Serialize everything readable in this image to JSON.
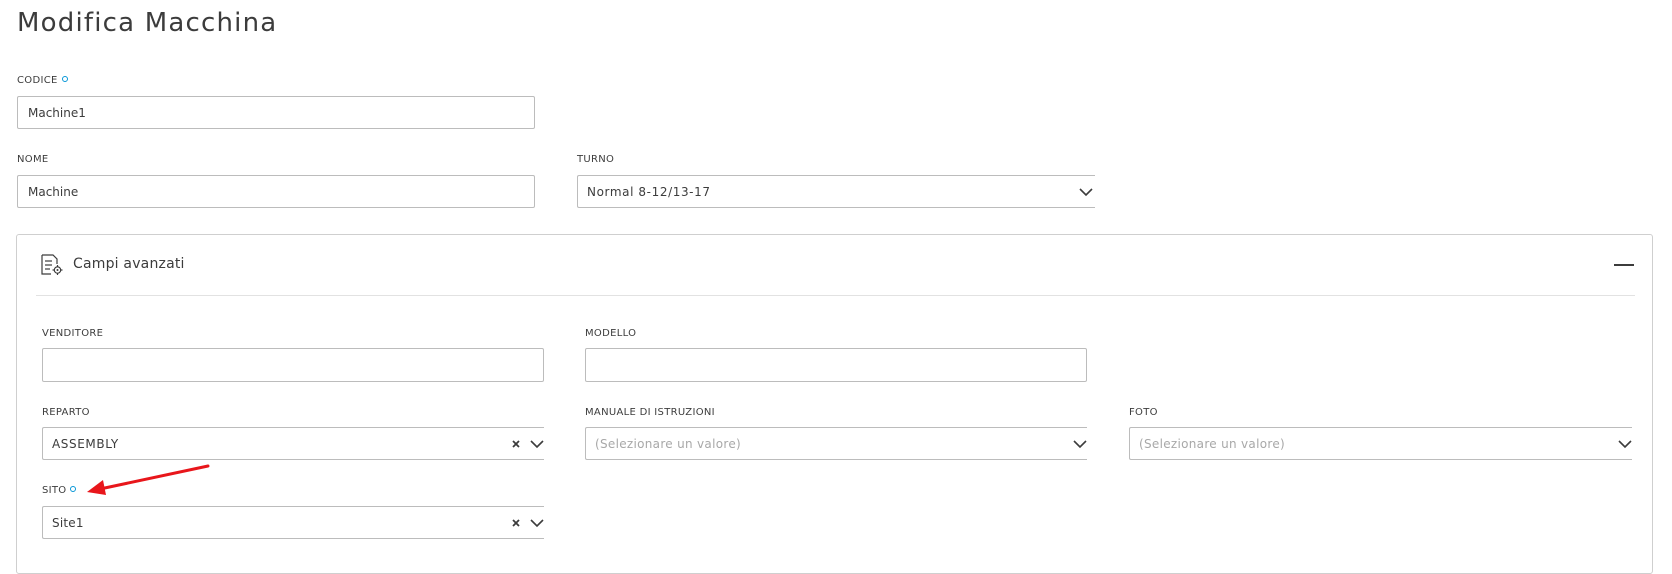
{
  "page": {
    "title": "Modifica Macchina"
  },
  "fields": {
    "codice": {
      "label": "CODICE",
      "value": "Machine1"
    },
    "nome": {
      "label": "NOME",
      "value": "Machine"
    },
    "turno": {
      "label": "TURNO",
      "value": "Normal 8-12/13-17"
    }
  },
  "advanced": {
    "title": "Campi avanzati",
    "collapse_icon": "minus-icon",
    "venditore": {
      "label": "VENDITORE",
      "value": ""
    },
    "modello": {
      "label": "MODELLO",
      "value": ""
    },
    "reparto": {
      "label": "REPARTO",
      "value": "ASSEMBLY"
    },
    "manuale": {
      "label": "MANUALE DI ISTRUZIONI",
      "placeholder": "(Selezionare un valore)"
    },
    "foto": {
      "label": "FOTO",
      "placeholder": "(Selezionare un valore)"
    },
    "sito": {
      "label": "SITO",
      "value": "Site1"
    }
  },
  "colors": {
    "required_dot": "#0696d7",
    "annotation_arrow": "#e8161b",
    "border": "#bcbcbc"
  }
}
